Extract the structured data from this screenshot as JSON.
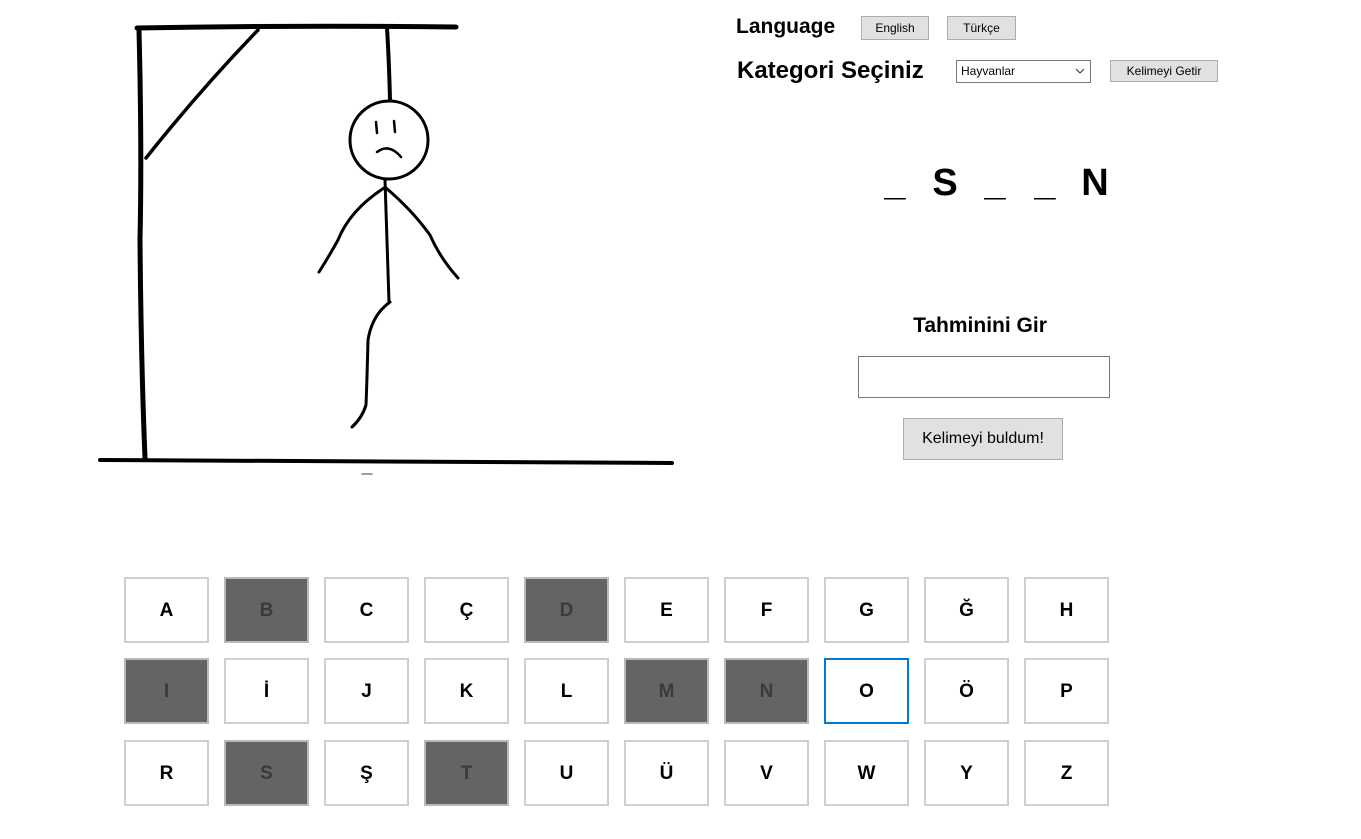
{
  "header": {
    "language_label": "Language",
    "english_button": "English",
    "turkish_button": "Türkçe",
    "category_label": "Kategori Seçiniz",
    "category_selected": "Hayvanlar",
    "get_word_button": "Kelimeyi Getir"
  },
  "word": {
    "slots": [
      "_",
      "S",
      "_",
      "_",
      "N"
    ]
  },
  "guess": {
    "label": "Tahminini Gir",
    "value": "",
    "submit_button": "Kelimeyi buldum!"
  },
  "letters": {
    "rows": [
      [
        {
          "char": "A",
          "used": false
        },
        {
          "char": "B",
          "used": true
        },
        {
          "char": "C",
          "used": false
        },
        {
          "char": "Ç",
          "used": false
        },
        {
          "char": "D",
          "used": true
        },
        {
          "char": "E",
          "used": false
        },
        {
          "char": "F",
          "used": false
        },
        {
          "char": "G",
          "used": false
        },
        {
          "char": "Ğ",
          "used": false
        },
        {
          "char": "H",
          "used": false
        }
      ],
      [
        {
          "char": "I",
          "used": true
        },
        {
          "char": "İ",
          "used": false
        },
        {
          "char": "J",
          "used": false
        },
        {
          "char": "K",
          "used": false
        },
        {
          "char": "L",
          "used": false
        },
        {
          "char": "M",
          "used": true
        },
        {
          "char": "N",
          "used": true
        },
        {
          "char": "O",
          "used": false,
          "focused": true
        },
        {
          "char": "Ö",
          "used": false
        },
        {
          "char": "P",
          "used": false
        }
      ],
      [
        {
          "char": "R",
          "used": false
        },
        {
          "char": "S",
          "used": true
        },
        {
          "char": "Ş",
          "used": false
        },
        {
          "char": "T",
          "used": true
        },
        {
          "char": "U",
          "used": false
        },
        {
          "char": "Ü",
          "used": false
        },
        {
          "char": "V",
          "used": false
        },
        {
          "char": "W",
          "used": false
        },
        {
          "char": "Y",
          "used": false
        },
        {
          "char": "Z",
          "used": false
        }
      ]
    ]
  },
  "colors": {
    "used_letter_bg": "#646464",
    "focus_border": "#0078d7",
    "button_bg": "#e1e1e1"
  },
  "icons": {
    "dropdown": "chevron-down-icon",
    "drawing": "hangman-drawing"
  }
}
